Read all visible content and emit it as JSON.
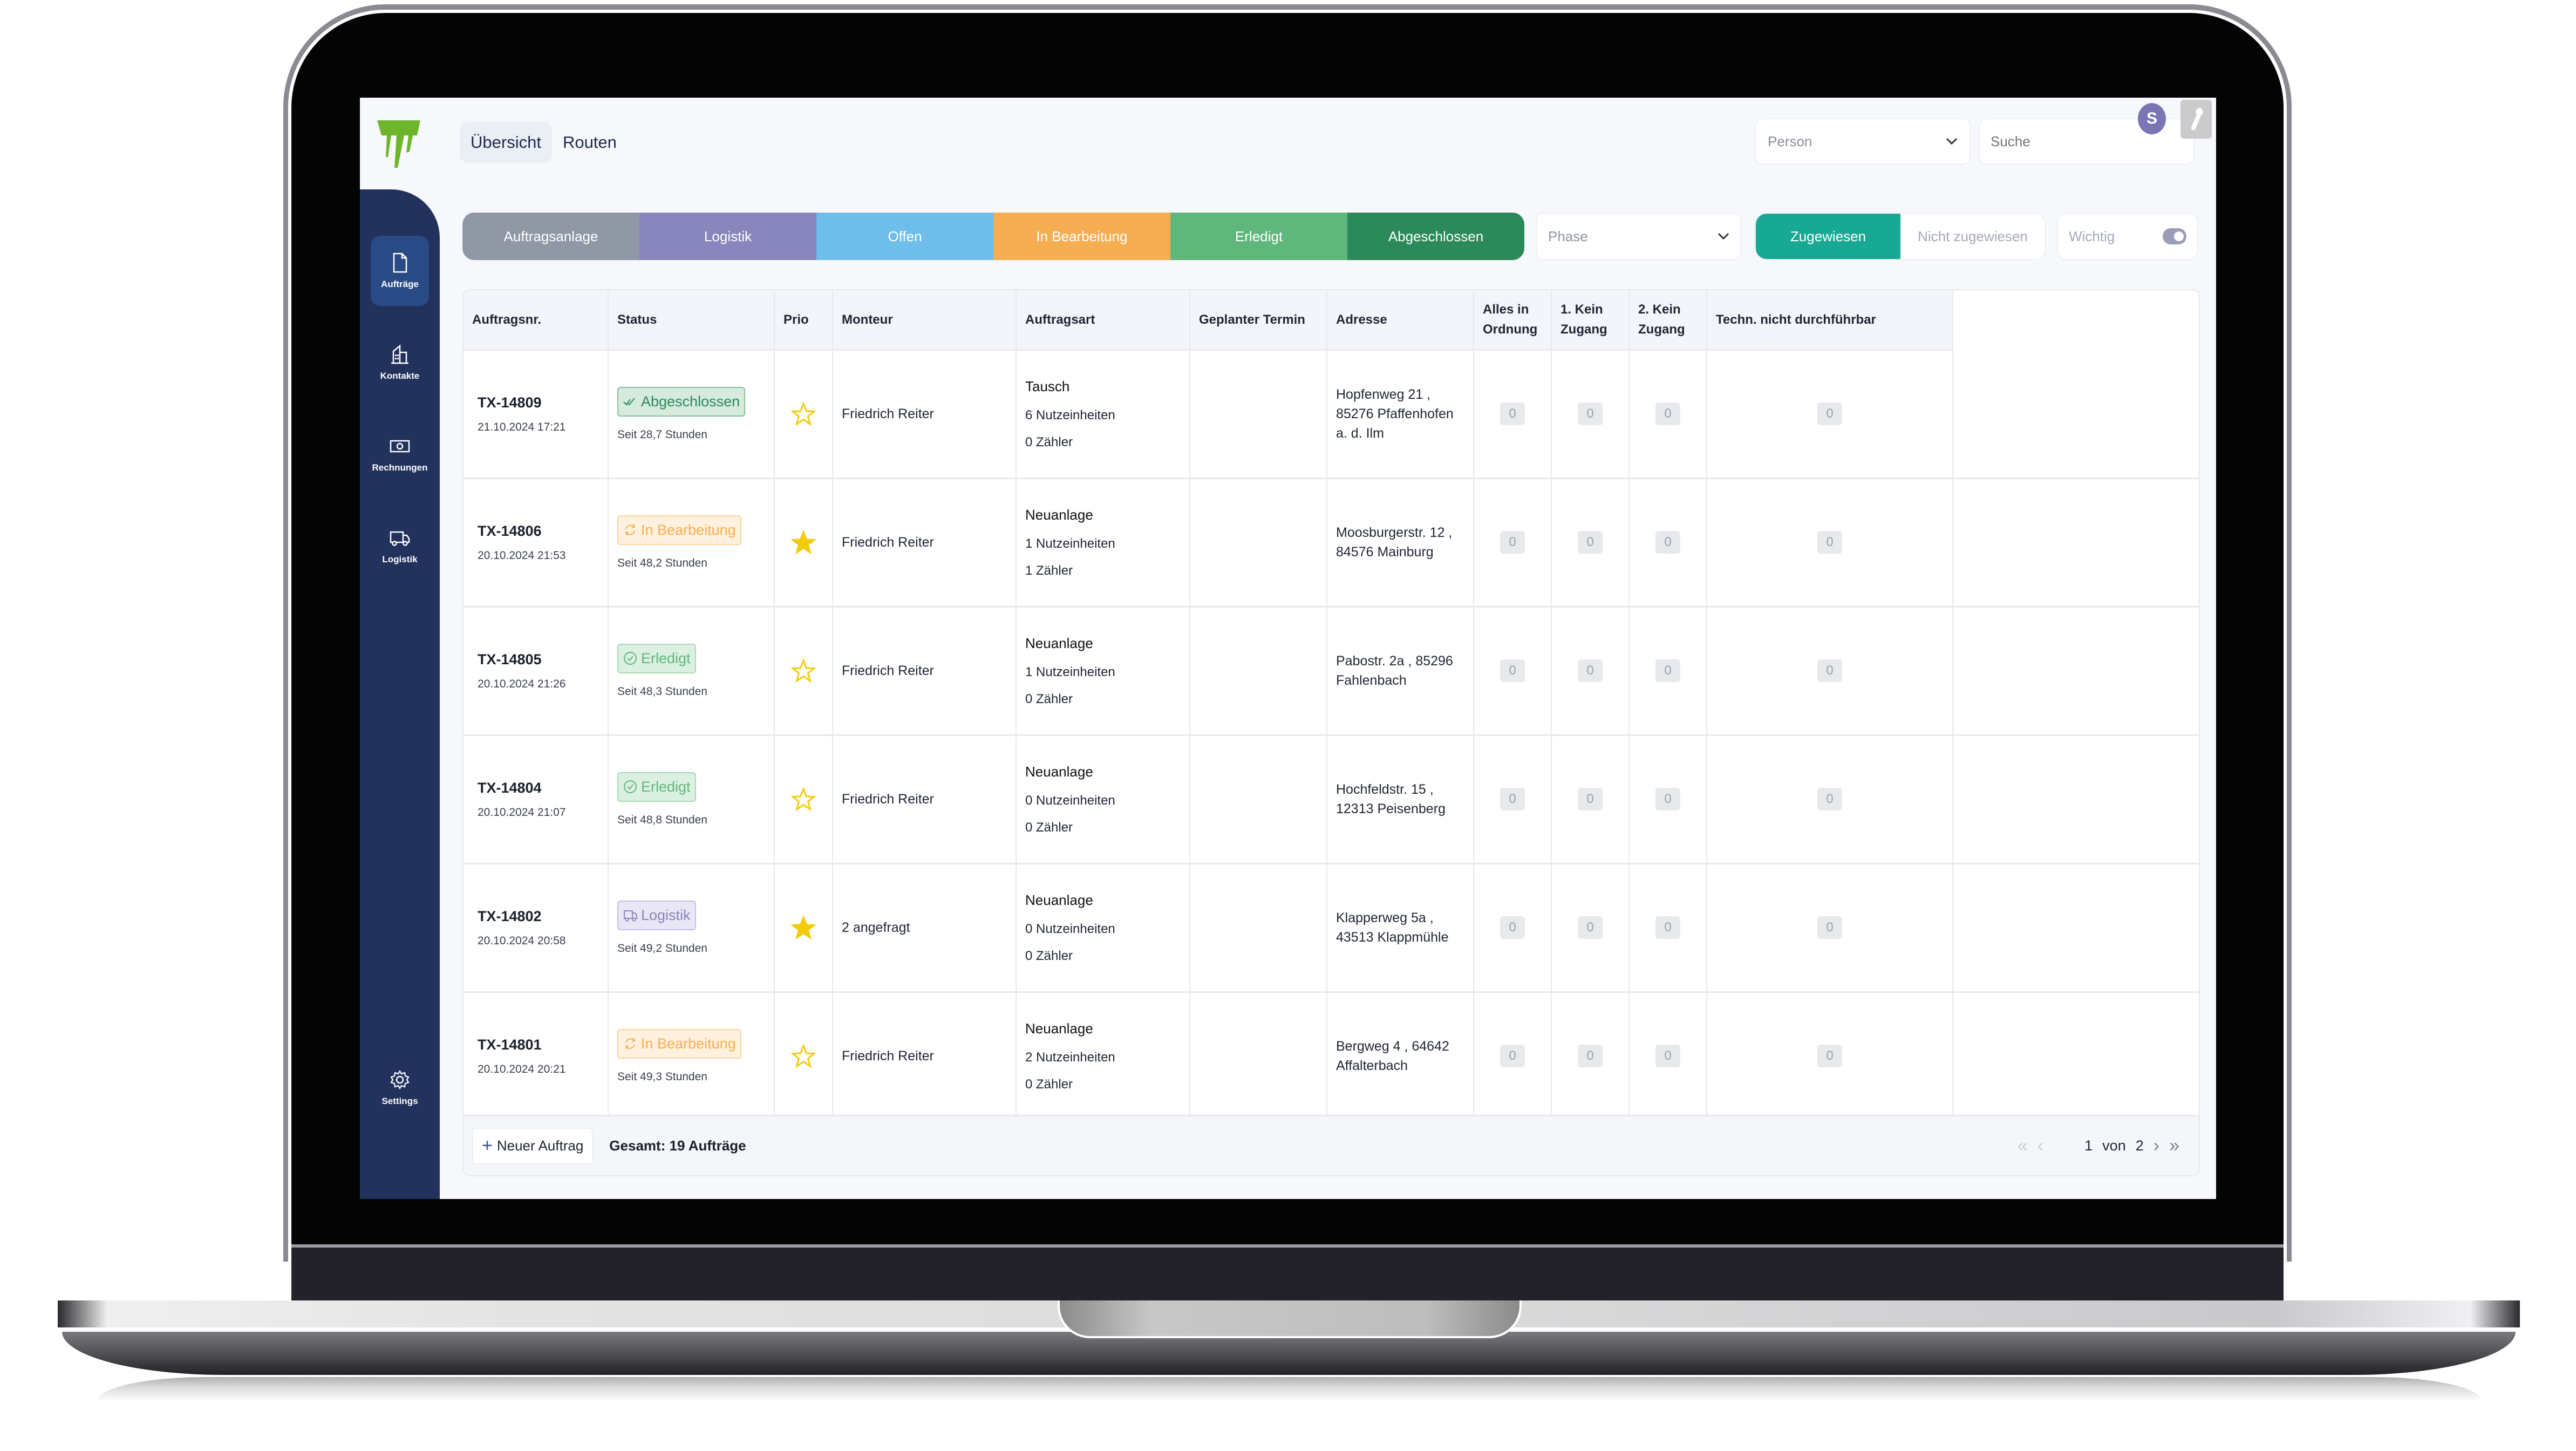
{
  "header": {
    "tabs": [
      {
        "label": "Übersicht",
        "active": true
      },
      {
        "label": "Routen",
        "active": false
      }
    ],
    "person_select": {
      "placeholder": "Person"
    },
    "search": {
      "placeholder": "Suche"
    },
    "avatar_initial": "S",
    "logo_color": "#6fb52c"
  },
  "sidebar": {
    "items": [
      {
        "label": "Aufträge",
        "icon": "document-icon",
        "active": true
      },
      {
        "label": "Kontakte",
        "icon": "building-icon",
        "active": false
      },
      {
        "label": "Rechnungen",
        "icon": "banknote-icon",
        "active": false
      },
      {
        "label": "Logistik",
        "icon": "truck-icon",
        "active": false
      }
    ],
    "settings_label": "Settings",
    "background": "#22325d"
  },
  "filters": {
    "phases": [
      {
        "label": "Auftragsanlage",
        "color": "#9097a5"
      },
      {
        "label": "Logistik",
        "color": "#8985bd"
      },
      {
        "label": "Offen",
        "color": "#6fbdeb"
      },
      {
        "label": "In Bearbeitung",
        "color": "#f6ae52"
      },
      {
        "label": "Erledigt",
        "color": "#5fb77b"
      },
      {
        "label": "Abgeschlossen",
        "color": "#2c895a"
      }
    ],
    "phase_select": {
      "placeholder": "Phase"
    },
    "assignment": [
      {
        "label": "Zugewiesen",
        "active": true
      },
      {
        "label": "Nicht zugewiesen",
        "active": false
      }
    ],
    "important_toggle": {
      "label": "Wichtig",
      "on": false
    }
  },
  "table": {
    "columns": [
      "Auftragsnr.",
      "Status",
      "Prio",
      "Monteur",
      "Auftragsart",
      "Geplanter Termin",
      "Adresse",
      "Alles in Ordnung",
      "1. Kein Zugang",
      "2. Kein Zugang",
      "Techn. nicht durchführbar"
    ],
    "rows": [
      {
        "order_no": "TX-14809",
        "date": "21.10.2024 17:21",
        "status": "Abgeschlossen",
        "status_kind": "closed",
        "since": "Seit 28,7 Stunden",
        "prio": false,
        "monteur": "Friedrich Reiter",
        "art": "Tausch",
        "units": "6 Nutzeinheiten",
        "meters": "0 Zähler",
        "termin": "",
        "address": "Hopfenweg 21 , 85276 Pfaffenhofen a. d. Ilm",
        "counts": [
          0,
          0,
          0,
          0
        ]
      },
      {
        "order_no": "TX-14806",
        "date": "20.10.2024 21:53",
        "status": "In Bearbeitung",
        "status_kind": "progress",
        "since": "Seit 48,2 Stunden",
        "prio": true,
        "monteur": "Friedrich Reiter",
        "art": "Neuanlage",
        "units": "1 Nutzeinheiten",
        "meters": "1 Zähler",
        "termin": "",
        "address": "Moosburgerstr. 12 , 84576 Mainburg",
        "counts": [
          0,
          0,
          0,
          0
        ]
      },
      {
        "order_no": "TX-14805",
        "date": "20.10.2024 21:26",
        "status": "Erledigt",
        "status_kind": "done",
        "since": "Seit 48,3 Stunden",
        "prio": false,
        "monteur": "Friedrich Reiter",
        "art": "Neuanlage",
        "units": "1 Nutzeinheiten",
        "meters": "0 Zähler",
        "termin": "",
        "address": "Pabostr. 2a , 85296 Fahlenbach",
        "counts": [
          0,
          0,
          0,
          0
        ]
      },
      {
        "order_no": "TX-14804",
        "date": "20.10.2024 21:07",
        "status": "Erledigt",
        "status_kind": "done",
        "since": "Seit 48,8 Stunden",
        "prio": false,
        "monteur": "Friedrich Reiter",
        "art": "Neuanlage",
        "units": "0 Nutzeinheiten",
        "meters": "0 Zähler",
        "termin": "",
        "address": "Hochfeldstr. 15 , 12313 Peisenberg",
        "counts": [
          0,
          0,
          0,
          0
        ]
      },
      {
        "order_no": "TX-14802",
        "date": "20.10.2024 20:58",
        "status": "Logistik",
        "status_kind": "logistics",
        "since": "Seit 49,2 Stunden",
        "prio": true,
        "monteur": "2 angefragt",
        "art": "Neuanlage",
        "units": "0 Nutzeinheiten",
        "meters": "0 Zähler",
        "termin": "",
        "address": "Klapperweg 5a , 43513 Klappmühle",
        "counts": [
          0,
          0,
          0,
          0
        ]
      },
      {
        "order_no": "TX-14801",
        "date": "20.10.2024 20:21",
        "status": "In Bearbeitung",
        "status_kind": "progress",
        "since": "Seit 49,3 Stunden",
        "prio": false,
        "monteur": "Friedrich Reiter",
        "art": "Neuanlage",
        "units": "2 Nutzeinheiten",
        "meters": "0 Zähler",
        "termin": "",
        "address": "Bergweg 4 , 64642 Affalterbach",
        "counts": [
          0,
          0,
          0,
          0
        ]
      }
    ],
    "status_styles": {
      "closed": {
        "bg": "#d6eadd",
        "border": "#86c29b",
        "color": "#2c895a"
      },
      "progress": {
        "bg": "#fff1dd",
        "border": "#fbd4a0",
        "color": "#f6ae52"
      },
      "done": {
        "bg": "#dcf0e2",
        "border": "#a7d9b5",
        "color": "#5fb77b"
      },
      "logistics": {
        "bg": "#e9e6f5",
        "border": "#c6c0e3",
        "color": "#8985bd"
      }
    },
    "star_color": "#f2cc0c"
  },
  "footer": {
    "new_order_label": "Neuer Auftrag",
    "total_label": "Gesamt: 19 Aufträge",
    "pagination": {
      "current": "1",
      "of_label": "von",
      "total": "2"
    }
  }
}
